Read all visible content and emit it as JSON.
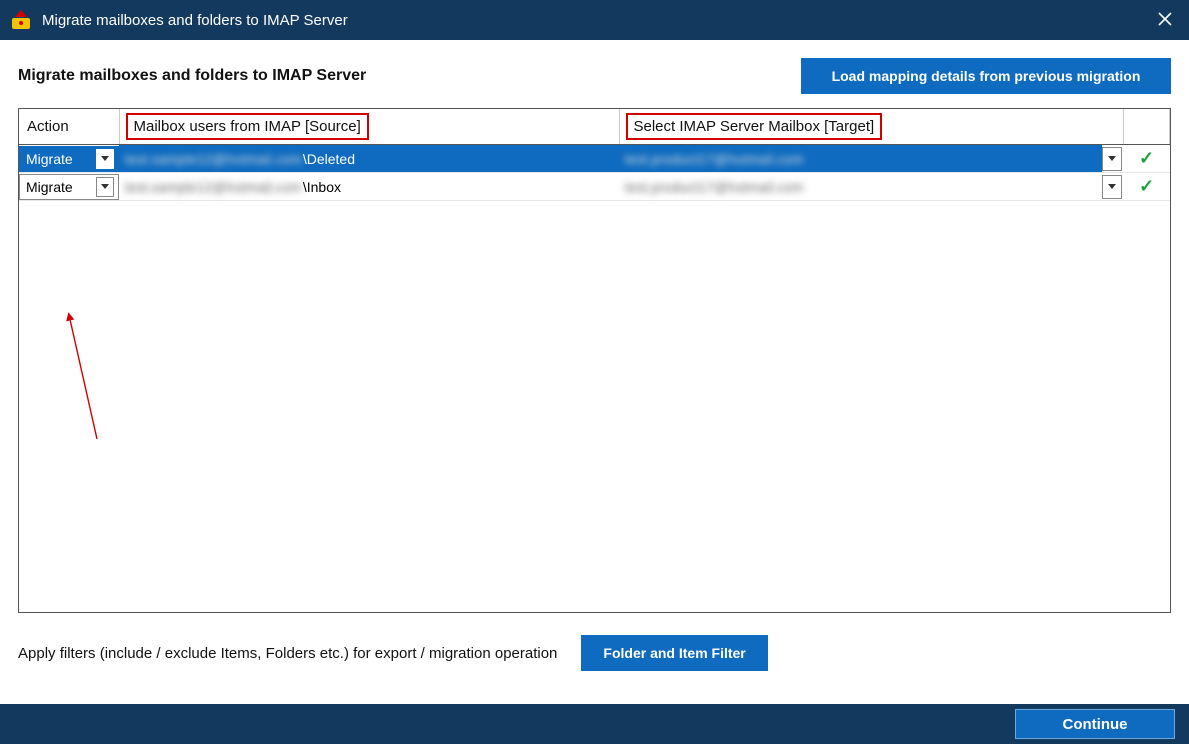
{
  "window": {
    "title": "Migrate mailboxes and folders to IMAP Server"
  },
  "header": {
    "title": "Migrate mailboxes and folders to IMAP Server",
    "load_button": "Load mapping details from previous migration"
  },
  "grid": {
    "columns": {
      "action": "Action",
      "source": "Mailbox users from IMAP [Source]",
      "target": "Select IMAP Server Mailbox [Target]"
    },
    "rows": [
      {
        "action": "Migrate",
        "source_obscured": "test.sample12@hotmail.com",
        "source_folder": "\\Deleted",
        "target_obscured": "test.product17@hotmail.com",
        "selected": true
      },
      {
        "action": "Migrate",
        "source_obscured": "test.sample12@hotmail.com",
        "source_folder": "\\Inbox",
        "target_obscured": "test.product17@hotmail.com",
        "selected": false
      }
    ]
  },
  "filters": {
    "text": "Apply filters (include / exclude Items, Folders etc.) for export / migration operation",
    "button": "Folder and Item Filter"
  },
  "footer": {
    "continue": "Continue"
  }
}
